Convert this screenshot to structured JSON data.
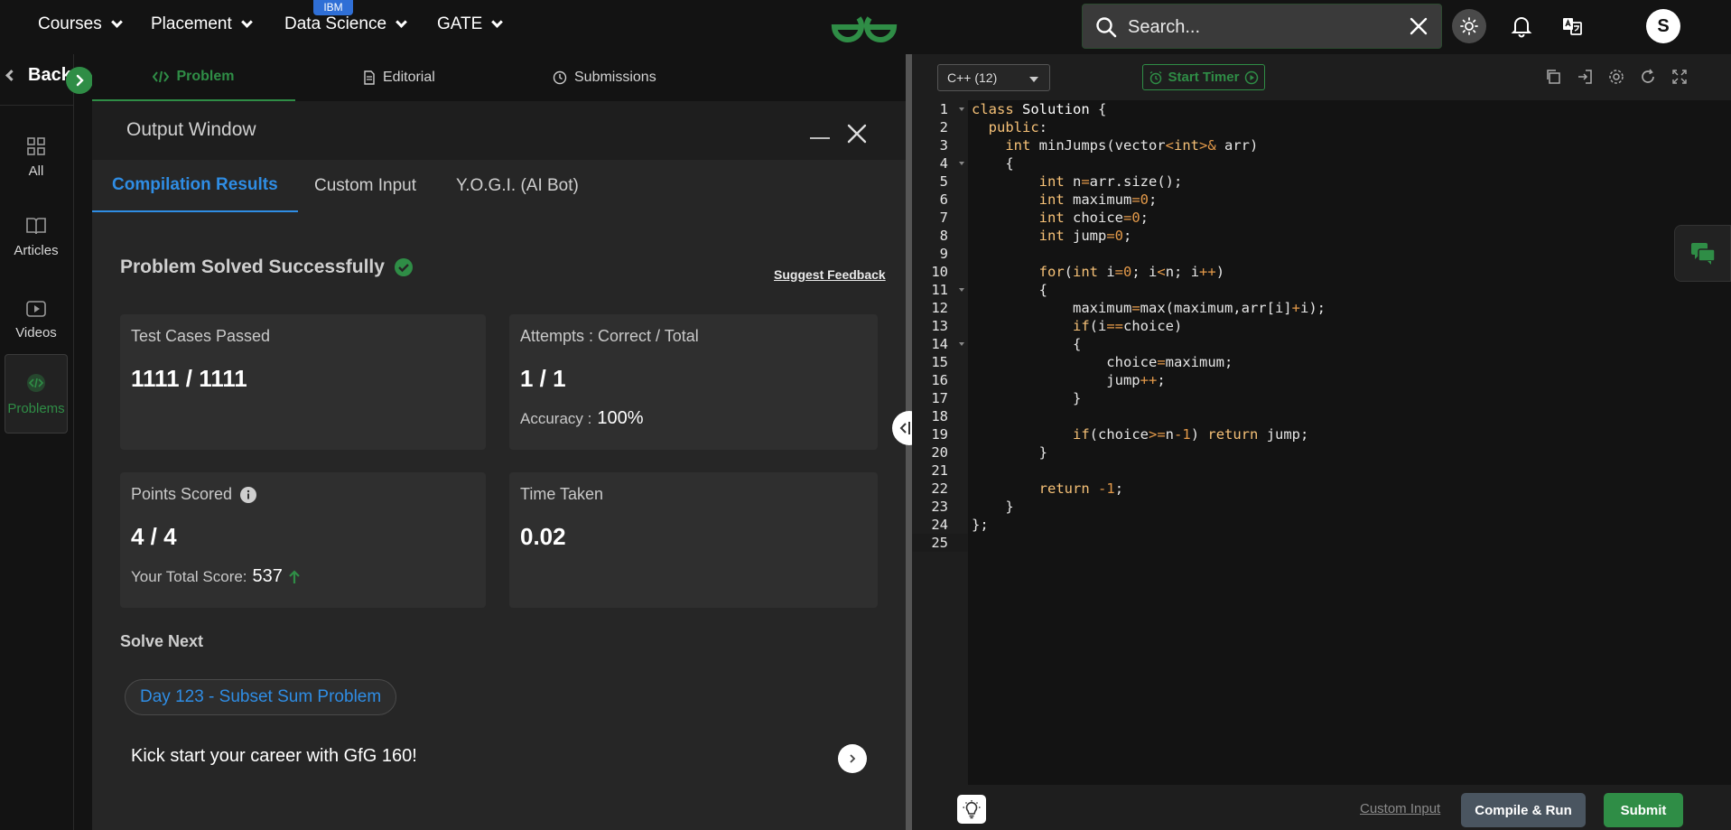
{
  "nav": {
    "items": [
      {
        "label": "Courses"
      },
      {
        "label": "Placement"
      },
      {
        "label": "Data Science"
      },
      {
        "label": "GATE"
      }
    ],
    "badge": "IBM"
  },
  "search": {
    "placeholder": "Search..."
  },
  "user": {
    "initial": "S"
  },
  "sidebar": {
    "back_label": "Back",
    "items": [
      {
        "label": "All"
      },
      {
        "label": "Articles"
      },
      {
        "label": "Videos"
      },
      {
        "label": "Problems"
      }
    ]
  },
  "problem_tabs": [
    {
      "label": "Problem"
    },
    {
      "label": "Editorial"
    },
    {
      "label": "Submissions"
    }
  ],
  "output": {
    "title": "Output Window",
    "tabs": [
      {
        "label": "Compilation Results"
      },
      {
        "label": "Custom Input"
      },
      {
        "label": "Y.O.G.I. (AI Bot)"
      }
    ],
    "status": "Problem Solved Successfully",
    "feedback": "Suggest Feedback",
    "cards": {
      "tests": {
        "label": "Test Cases Passed",
        "value": "1111 / 1111"
      },
      "attempts": {
        "label": "Attempts : Correct / Total",
        "value": "1 / 1",
        "sub_label": "Accuracy :",
        "sub_value": "100%"
      },
      "points": {
        "label": "Points Scored",
        "value": "4 / 4",
        "sub_label": "Your Total Score:",
        "sub_value": "537"
      },
      "time": {
        "label": "Time Taken",
        "value": "0.02"
      }
    },
    "solve_next": "Solve Next",
    "next_problem": "Day 123 - Subset Sum Problem",
    "kickstart": "Kick start your career with GfG 160!"
  },
  "editor": {
    "language": "C++ (12)",
    "timer_label": "Start Timer",
    "custom_input": "Custom Input",
    "compile_label": "Compile & Run",
    "submit_label": "Submit",
    "line_numbers": [
      "1",
      "2",
      "3",
      "4",
      "5",
      "6",
      "7",
      "8",
      "9",
      "10",
      "11",
      "12",
      "13",
      "14",
      "15",
      "16",
      "17",
      "18",
      "19",
      "20",
      "21",
      "22",
      "23",
      "24",
      "25"
    ]
  },
  "colors": {
    "brand_green": "#2f8d46",
    "link_blue": "#2f8de4",
    "background": "#131313"
  }
}
